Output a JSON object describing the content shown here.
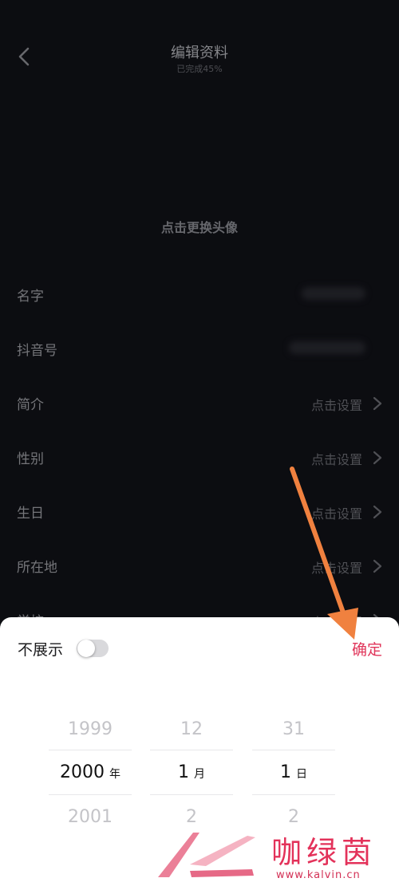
{
  "header": {
    "title": "编辑资料",
    "subtitle": "已完成45%"
  },
  "avatar": {
    "change_text": "点击更换头像"
  },
  "rows": [
    {
      "label": "名字",
      "value": ""
    },
    {
      "label": "抖音号",
      "value": ""
    },
    {
      "label": "简介",
      "value": "点击设置"
    },
    {
      "label": "性别",
      "value": "点击设置"
    },
    {
      "label": "生日",
      "value": "点击设置"
    },
    {
      "label": "所在地",
      "value": "点击设置"
    },
    {
      "label": "学校",
      "value": "点击设置"
    }
  ],
  "picker": {
    "hide_label": "不展示",
    "hide_toggle_on": false,
    "confirm_label": "确定",
    "year": {
      "prev": "1999",
      "selected": "2000",
      "next": "2001",
      "unit": "年"
    },
    "month": {
      "prev": "12",
      "selected": "1",
      "next": "2",
      "unit": "月"
    },
    "day": {
      "prev": "31",
      "selected": "1",
      "next": "2",
      "unit": "日"
    }
  },
  "watermark": {
    "text": "咖绿茵",
    "url": "www.kalvin.cn"
  },
  "colors": {
    "accent": "#e0355a",
    "background": "#111218",
    "arrow": "#f0813f"
  }
}
